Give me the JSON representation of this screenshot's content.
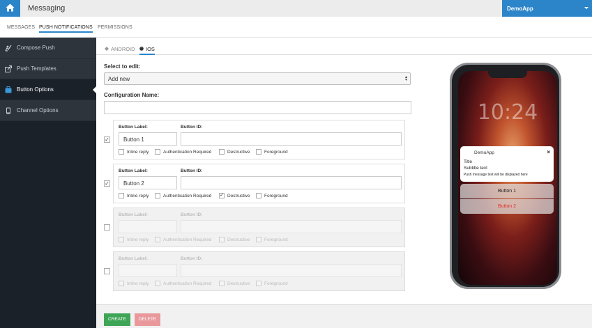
{
  "header": {
    "home_icon": "home-icon",
    "title": "Messaging",
    "app_selector": "DemoApp"
  },
  "subnav": {
    "tabs": [
      {
        "label": "MESSAGES",
        "active": false
      },
      {
        "label": "PUSH NOTIFICATIONS",
        "active": true
      },
      {
        "label": "PERMISSIONS",
        "active": false
      }
    ]
  },
  "sidebar": {
    "items": [
      {
        "label": "Compose Push",
        "icon": "compose-icon",
        "active": false
      },
      {
        "label": "Push Templates",
        "icon": "external-link-icon",
        "active": false
      },
      {
        "label": "Button Options",
        "icon": "briefcase-icon",
        "active": true
      },
      {
        "label": "Channel Options",
        "icon": "phone-icon",
        "active": false
      }
    ]
  },
  "platform_tabs": [
    {
      "label": "ANDROID",
      "icon": "android-icon",
      "active": false
    },
    {
      "label": "IOS",
      "icon": "apple-icon",
      "active": true
    }
  ],
  "form": {
    "select_label": "Select to edit:",
    "select_value": "Add new",
    "config_label": "Configuration Name:",
    "config_value": "",
    "button_label_header": "Button Label:",
    "button_id_header": "Button ID:",
    "options": [
      "Inline reply",
      "Authentication Required",
      "Destructive",
      "Foreground"
    ],
    "rows": [
      {
        "enabled": true,
        "label": "Button 1",
        "id": "",
        "checks": [
          false,
          false,
          false,
          false
        ]
      },
      {
        "enabled": true,
        "label": "Button 2",
        "id": "",
        "checks": [
          false,
          false,
          true,
          false
        ]
      },
      {
        "enabled": false,
        "label": "",
        "id": "",
        "checks": [
          false,
          false,
          false,
          false
        ]
      },
      {
        "enabled": false,
        "label": "",
        "id": "",
        "checks": [
          false,
          false,
          false,
          false
        ]
      }
    ]
  },
  "footer": {
    "create_label": "CREATE",
    "delete_label": "DELETE"
  },
  "preview": {
    "clock": "10:24",
    "app_name": "DemoApp",
    "close": "×",
    "title": "Title",
    "subtitle": "Subtitle text",
    "message": "Push message text will be displayed here",
    "action_1": "Button 1",
    "action_2": "Button 2"
  },
  "colors": {
    "primary": "#2c85c9",
    "sidebar_bg": "#1b2129",
    "create_green": "#3fa556",
    "delete_red": "#e9999c",
    "destructive_text": "#e0332e"
  }
}
